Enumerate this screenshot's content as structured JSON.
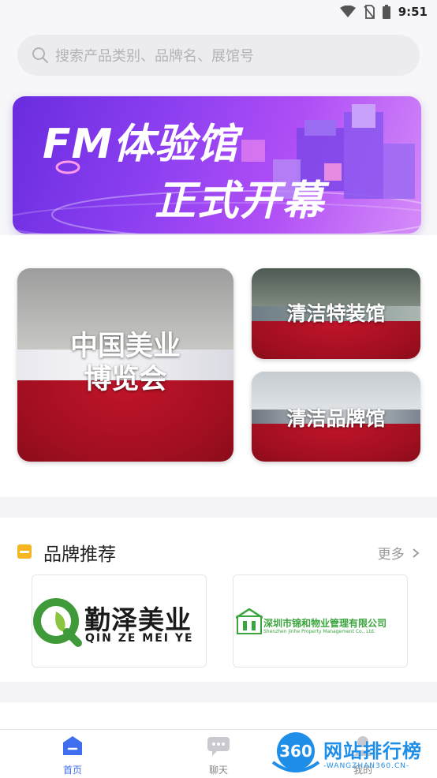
{
  "status_bar": {
    "time": "9:51",
    "icons": [
      "wifi-icon",
      "no-sim-icon",
      "battery-icon"
    ]
  },
  "search": {
    "placeholder": "搜索产品类别、品牌名、展馆号"
  },
  "banner": {
    "line1": "FM体验馆",
    "line2": "正式开幕"
  },
  "halls": [
    {
      "label_line1": "中国美业",
      "label_line2": "博览会"
    },
    {
      "label": "清洁特装馆"
    },
    {
      "label": "清洁品牌馆"
    }
  ],
  "brand_section": {
    "title": "品牌推荐",
    "more_label": "更多",
    "brands": [
      {
        "name": "勤泽美业",
        "subtitle": "QIN ZE MEI YE"
      },
      {
        "name": "深圳市锦和物业管理有限公司",
        "subtitle": "Shenzhen Jinhe Property Management Co., Ltd."
      }
    ]
  },
  "tab_bar": {
    "tabs": [
      {
        "label": "首页",
        "icon": "home-icon",
        "active": true
      },
      {
        "label": "聊天",
        "icon": "chat-icon",
        "active": false
      },
      {
        "label": "我的",
        "icon": "profile-icon",
        "active": false
      }
    ]
  },
  "watermark": {
    "text": "网站排行榜",
    "sub": "-WANGZHAN360.CN-",
    "badge": "360"
  },
  "colors": {
    "accent": "#3f6ef0",
    "banner_start": "#6a2ce0",
    "banner_end": "#d58cf9",
    "carpet": "#b0112a",
    "brand_green": "#3aa53d"
  }
}
